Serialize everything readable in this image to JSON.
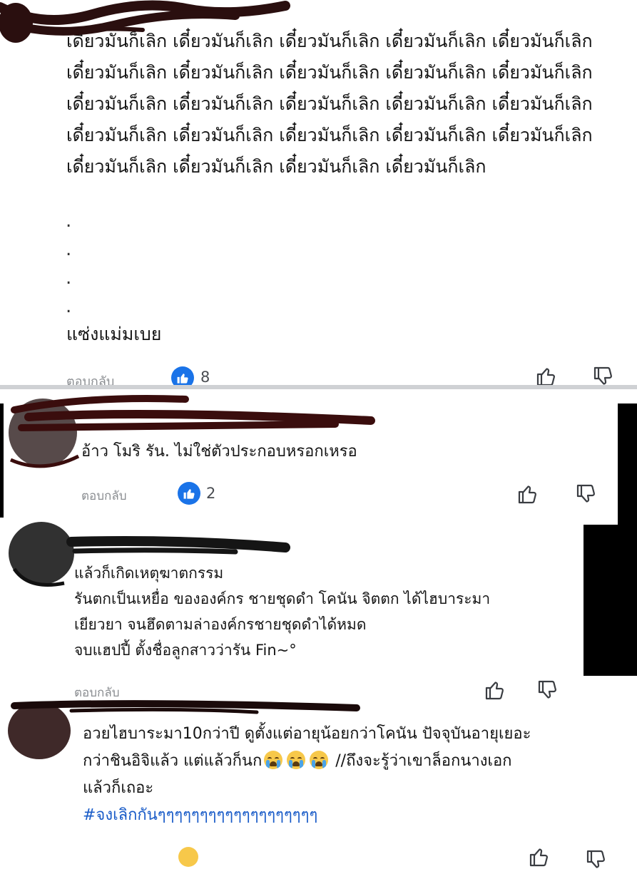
{
  "top_comment": {
    "body": "เดี๋ยวมันก็เลิก เดี๋ยวมันก็เลิก เดี๋ยวมันก็เลิก เดี๋ยวมันก็เลิก เดี๋ยวมันก็เลิก เดี๋ยวมันก็เลิก เดี๋ยวมันก็เลิก เดี๋ยวมันก็เลิก เดี๋ยวมันก็เลิก เดี๋ยวมันก็เลิก เดี๋ยวมันก็เลิก เดี๋ยวมันก็เลิก เดี๋ยวมันก็เลิก เดี๋ยวมันก็เลิก เดี๋ยวมันก็เลิก เดี๋ยวมันก็เลิก เดี๋ยวมันก็เลิก เดี๋ยวมันก็เลิก เดี๋ยวมันก็เลิก เดี๋ยวมันก็เลิก เดี๋ยวมันก็เลิก เดี๋ยวมันก็เลิก เดี๋ยวมันก็เลิก เดี๋ยวมันก็เลิก",
    "dots": [
      ".",
      ".",
      ".",
      "."
    ],
    "last_line": "แซ่งแม่มเบย",
    "reply_label": "ตอบกลับ",
    "like_count": "8"
  },
  "comment_2": {
    "text": "อ้าว โมริ รัน.  ไม่ใช่ตัวประกอบหรอกเหรอ",
    "reply_label": "ตอบกลับ",
    "like_count": "2"
  },
  "comment_3": {
    "lines": [
      "แล้วก็เกิดเหตุฆาตกรรม",
      "รันตกเป็นเหยื่อ ขององค์กร ชายชุดดำ โคนัน จิตตก ได้ไฮบาระมา",
      "เยียวยา  จนฮึดตามล่าองค์กรชายชุดดำได้หมด",
      "จบแฮปปี้ ตั้งชื่อลูกสาวว่ารัน  Fin~°"
    ],
    "reply_label": "ตอบกลับ"
  },
  "comment_4": {
    "line1": "อวยไฮบาระมา10กว่าปี ดูตั้งแต่อายุน้อยกว่าโคนัน ปัจจุบันอายุเยอะ",
    "line2_before": "กว่าชินอิจิแล้ว แต่แล้วก็นก",
    "line2_after": "  //ถึงจะรู้ว่าเขาล็อกนางเอก",
    "line3": "แล้วก็เถอะ",
    "hashtag": "#จงเลิกกันๆๆๆๆๆๆๆๆๆๆๆๆๆๆๆๆๆๆๆ"
  },
  "icons": {
    "like_badge": "thumbs-up-badge-icon",
    "like": "thumbs-up-outline-icon",
    "dislike": "thumbs-down-outline-icon",
    "reaction": "crying-emoji-icon"
  },
  "colors": {
    "like_badge": "#1a73e8",
    "hashtag": "#1a5cc8",
    "muted_text": "#8a8d91",
    "scribble": "#2a0f0f"
  }
}
